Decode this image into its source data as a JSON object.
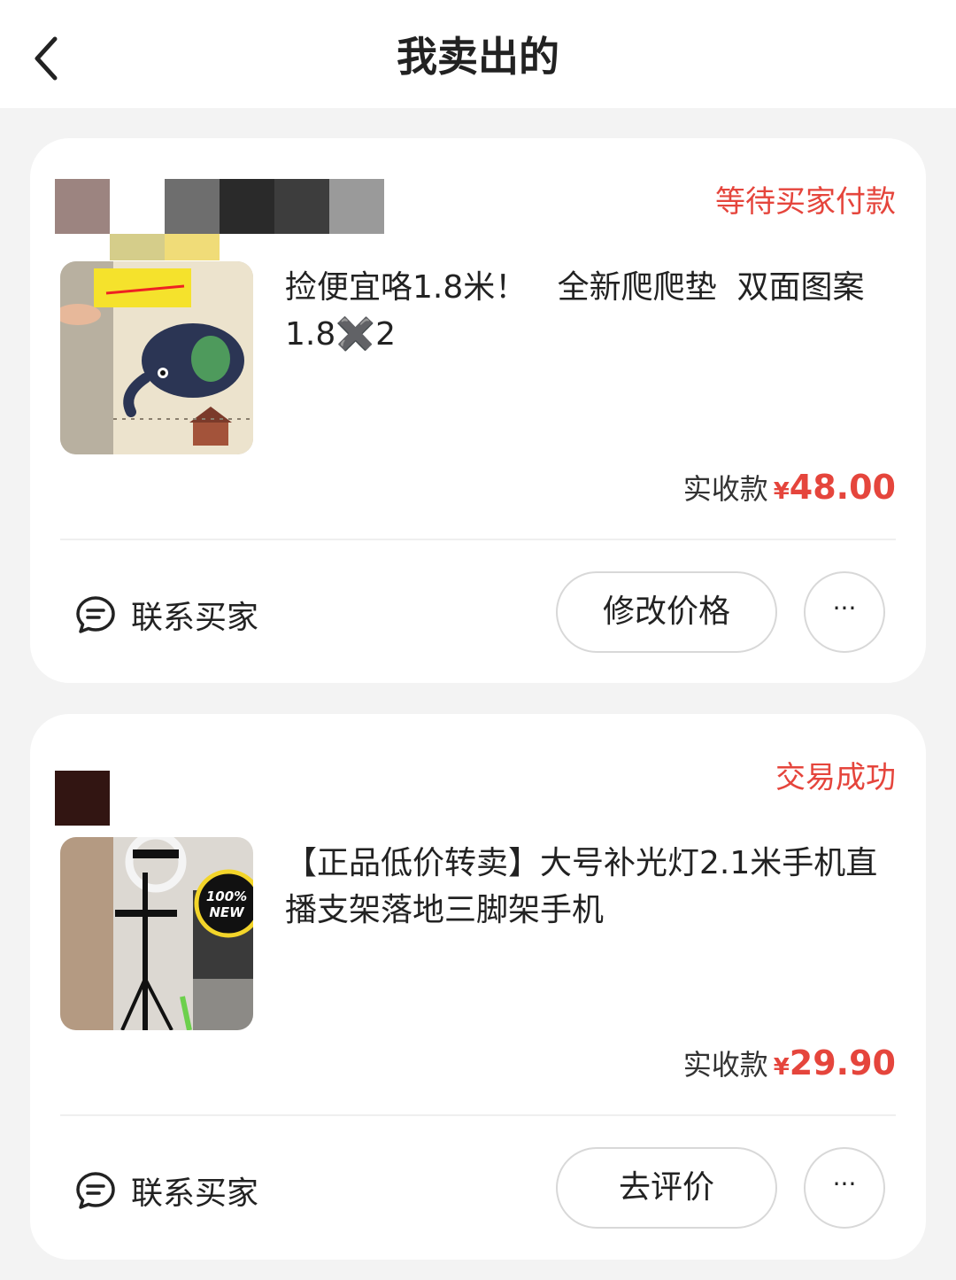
{
  "header": {
    "title": "我卖出的",
    "back_icon": "chevron-left-icon"
  },
  "orders": [
    {
      "status": "等待买家付款",
      "product_title": "捡便宜咯1.8米！   全新爬爬垫  双面图案1.8✖️2",
      "amount_label": "实收款",
      "currency": "¥",
      "amount": "48.00",
      "contact_label": "联系买家",
      "action_label": "修改价格",
      "more_label": "···"
    },
    {
      "status": "交易成功",
      "product_title": "【正品低价转卖】大号补光灯2.1米手机直播支架落地三脚架手机",
      "amount_label": "实收款",
      "currency": "¥",
      "amount": "29.90",
      "contact_label": "联系买家",
      "action_label": "去评价",
      "more_label": "···"
    }
  ],
  "colors": {
    "accent": "#e5453c",
    "background": "#f3f3f3",
    "card": "#ffffff"
  }
}
